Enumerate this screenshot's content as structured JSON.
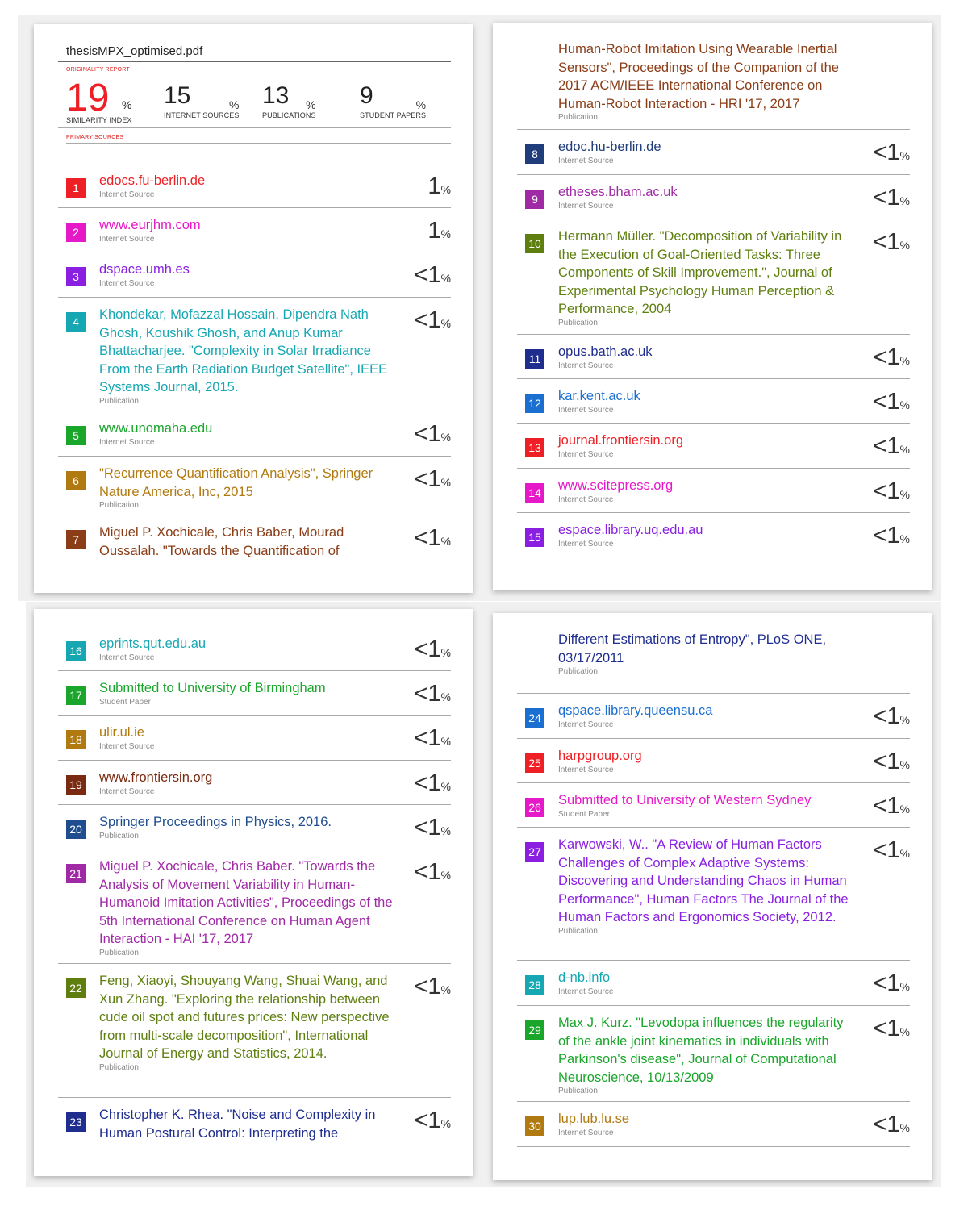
{
  "report": {
    "filename": "thesisMPX_optimised.pdf",
    "originality_label": "ORIGINALITY REPORT",
    "primary_sources_label": "PRIMARY SOURCES",
    "similarity": {
      "value": "19",
      "unit": "%",
      "label": "SIMILARITY INDEX"
    },
    "internet": {
      "value": "15",
      "unit": "%",
      "label": "INTERNET SOURCES"
    },
    "publications": {
      "value": "13",
      "unit": "%",
      "label": "PUBLICATIONS"
    },
    "student": {
      "value": "9",
      "unit": "%",
      "label": "STUDENT PAPERS"
    }
  },
  "p2_cont": {
    "text": "Human-Robot Imitation Using Wearable Inertial Sensors\", Proceedings of the Companion of the 2017 ACM/IEEE International Conference on Human-Robot Interaction - HRI '17, 2017",
    "type": "Publication",
    "color": "#8a3d17"
  },
  "p4_cont": {
    "text": "Different Estimations of Entropy\", PLoS ONE, 03/17/2011",
    "type": "Publication",
    "color": "#1f2d8f"
  },
  "sources": [
    {
      "num": "1",
      "text": "edocs.fu-berlin.de",
      "type": "Internet Source",
      "pct": "1",
      "less": "",
      "color": "#ee1f25"
    },
    {
      "num": "2",
      "text": "www.eurjhm.com",
      "type": "Internet Source",
      "pct": "1",
      "less": "",
      "color": "#e619c8"
    },
    {
      "num": "3",
      "text": "dspace.umh.es",
      "type": "Internet Source",
      "pct": "1",
      "less": "<",
      "color": "#8a1fe2"
    },
    {
      "num": "4",
      "text": "Khondekar, Mofazzal Hossain, Dipendra Nath Ghosh, Koushik Ghosh, and Anup Kumar Bhattacharjee. \"Complexity in Solar Irradiance From the Earth Radiation Budget Satellite\", IEEE Systems Journal, 2015.",
      "type": "Publication",
      "pct": "1",
      "less": "<",
      "color": "#17a7b3"
    },
    {
      "num": "5",
      "text": "www.unomaha.edu",
      "type": "Internet Source",
      "pct": "1",
      "less": "<",
      "color": "#1aa52b"
    },
    {
      "num": "6",
      "text": "\"Recurrence Quantification Analysis\", Springer Nature America, Inc, 2015",
      "type": "Publication",
      "pct": "1",
      "less": "<",
      "color": "#b17a11"
    },
    {
      "num": "7",
      "text": "Miguel P. Xochicale, Chris Baber, Mourad Oussalah. \"Towards the Quantification of",
      "type": "",
      "pct": "1",
      "less": "<",
      "color": "#8a3d17"
    },
    {
      "num": "8",
      "text": "edoc.hu-berlin.de",
      "type": "Internet Source",
      "pct": "1",
      "less": "<",
      "color": "#1f3d7a"
    },
    {
      "num": "9",
      "text": "etheses.bham.ac.uk",
      "type": "Internet Source",
      "pct": "1",
      "less": "<",
      "color": "#a02aa6"
    },
    {
      "num": "10",
      "text": "Hermann Müller. \"Decomposition of Variability in the Execution of Goal-Oriented Tasks: Three Components of Skill Improvement.\", Journal of Experimental Psychology Human Perception & Performance, 2004",
      "type": "Publication",
      "pct": "1",
      "less": "<",
      "color": "#5e7f0f"
    },
    {
      "num": "11",
      "text": "opus.bath.ac.uk",
      "type": "Internet Source",
      "pct": "1",
      "less": "<",
      "color": "#1f2d8f"
    },
    {
      "num": "12",
      "text": "kar.kent.ac.uk",
      "type": "Internet Source",
      "pct": "1",
      "less": "<",
      "color": "#1a6fd1"
    },
    {
      "num": "13",
      "text": "journal.frontiersin.org",
      "type": "Internet Source",
      "pct": "1",
      "less": "<",
      "color": "#ee1f25"
    },
    {
      "num": "14",
      "text": "www.scitepress.org",
      "type": "Internet Source",
      "pct": "1",
      "less": "<",
      "color": "#e619c8"
    },
    {
      "num": "15",
      "text": "espace.library.uq.edu.au",
      "type": "Internet Source",
      "pct": "1",
      "less": "<",
      "color": "#8a1fe2"
    },
    {
      "num": "16",
      "text": "eprints.qut.edu.au",
      "type": "Internet Source",
      "pct": "1",
      "less": "<",
      "color": "#17a7b3"
    },
    {
      "num": "17",
      "text": "Submitted to University of Birmingham",
      "type": "Student Paper",
      "pct": "1",
      "less": "<",
      "color": "#1aa52b"
    },
    {
      "num": "18",
      "text": "ulir.ul.ie",
      "type": "Internet Source",
      "pct": "1",
      "less": "<",
      "color": "#b17a11"
    },
    {
      "num": "19",
      "text": "www.frontiersin.org",
      "type": "Internet Source",
      "pct": "1",
      "less": "<",
      "color": "#7a2a10"
    },
    {
      "num": "20",
      "text": "Springer Proceedings in Physics, 2016.",
      "type": "Publication",
      "pct": "1",
      "less": "<",
      "color": "#1f4d8f"
    },
    {
      "num": "21",
      "text": "Miguel P. Xochicale, Chris Baber. \"Towards the Analysis of Movement Variability in Human-Humanoid Imitation Activities\", Proceedings of the 5th International Conference on Human Agent Interaction - HAI '17, 2017",
      "type": "Publication",
      "pct": "1",
      "less": "<",
      "color": "#a02aa6"
    },
    {
      "num": "22",
      "text": "Feng, Xiaoyi, Shouyang Wang, Shuai Wang, and Xun Zhang. \"Exploring the relationship between cude oil spot and futures prices: New perspective from multi-scale decomposition\", International Journal of Energy and Statistics, 2014.",
      "type": "Publication",
      "pct": "1",
      "less": "<",
      "color": "#5e7f0f"
    },
    {
      "num": "23",
      "text": "Christopher K. Rhea. \"Noise and Complexity in Human Postural Control: Interpreting the",
      "type": "",
      "pct": "1",
      "less": "<",
      "color": "#1f2d8f"
    },
    {
      "num": "24",
      "text": "qspace.library.queensu.ca",
      "type": "Internet Source",
      "pct": "1",
      "less": "<",
      "color": "#1a6fd1"
    },
    {
      "num": "25",
      "text": "harpgroup.org",
      "type": "Internet Source",
      "pct": "1",
      "less": "<",
      "color": "#ee1f25"
    },
    {
      "num": "26",
      "text": "Submitted to University of Western Sydney",
      "type": "Student Paper",
      "pct": "1",
      "less": "<",
      "color": "#e619c8"
    },
    {
      "num": "27",
      "text": "Karwowski, W.. \"A Review of Human Factors Challenges of Complex Adaptive Systems: Discovering and Understanding Chaos in Human Performance\", Human Factors The Journal of the Human Factors and Ergonomics Society, 2012.",
      "type": "Publication",
      "pct": "1",
      "less": "<",
      "color": "#8a1fe2"
    },
    {
      "num": "28",
      "text": "d-nb.info",
      "type": "Internet Source",
      "pct": "1",
      "less": "<",
      "color": "#17a7b3"
    },
    {
      "num": "29",
      "text": "Max J. Kurz. \"Levodopa influences the regularity of the ankle joint kinematics in individuals with Parkinson's disease\", Journal of Computational Neuroscience, 10/13/2009",
      "type": "Publication",
      "pct": "1",
      "less": "<",
      "color": "#1aa52b"
    },
    {
      "num": "30",
      "text": "lup.lub.lu.se",
      "type": "Internet Source",
      "pct": "1",
      "less": "<",
      "color": "#b17a11"
    }
  ]
}
